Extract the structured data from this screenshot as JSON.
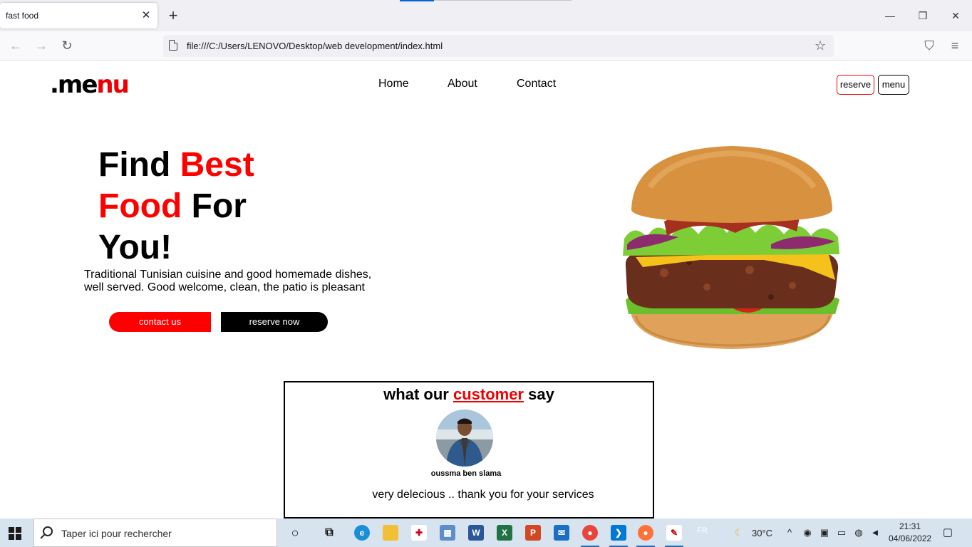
{
  "browser": {
    "tab_title": "fast food",
    "close_tab": "✕",
    "new_tab": "+",
    "url": "file:///C:/Users/LENOVO/Desktop/web development/index.html",
    "back": "←",
    "forward": "→",
    "reload": "↻",
    "bookmark": "☆",
    "pocket": "⛉",
    "app_menu": "≡",
    "minimize": "—",
    "restore": "❐",
    "close_window": "✕"
  },
  "site": {
    "logo_dot": ".",
    "logo_me": "me",
    "logo_nu": "nu",
    "nav": [
      "Home",
      "About",
      "Contact"
    ],
    "reserve_btn": "reserve",
    "menu_btn": "menu",
    "hero": {
      "line1_a": "Find ",
      "line1_b": "Best",
      "line2_a": "Food",
      "line2_b": " For",
      "line3": "You!",
      "description": "Traditional Tunisian cuisine and good homemade dishes, well served. Good welcome, clean, the patio is pleasant",
      "contact_btn": "contact us",
      "reserve_btn": "reserve now"
    },
    "review": {
      "title_a": "what our ",
      "title_b": "customer",
      "title_c": " say",
      "name": "oussma ben slama",
      "text": "very delecious .. thank you for your services"
    }
  },
  "taskbar": {
    "search_placeholder": "Taper ici pour rechercher",
    "lang": "FR",
    "weather": "30°C",
    "time": "21:31",
    "date": "04/06/2022"
  },
  "colors": {
    "accent_red": "#ff0000",
    "black": "#000000",
    "firefox_blue": "#0060df"
  }
}
